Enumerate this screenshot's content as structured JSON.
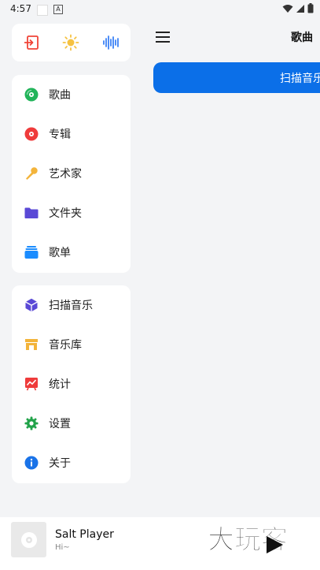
{
  "status": {
    "time": "4:57",
    "notif_letter": "A"
  },
  "quick_actions": [
    {
      "icon": "exit-icon",
      "color": "#f04438"
    },
    {
      "icon": "sun-icon",
      "color": "#f5c242"
    },
    {
      "icon": "waveform-icon",
      "color": "#3b82f6"
    }
  ],
  "library_nav": [
    {
      "label": "歌曲",
      "icon": "song-disc-icon",
      "color": "#22b45a"
    },
    {
      "label": "专辑",
      "icon": "album-icon",
      "color": "#ef3b3b"
    },
    {
      "label": "艺术家",
      "icon": "microphone-icon",
      "color": "#f3b43b"
    },
    {
      "label": "文件夹",
      "icon": "folder-icon",
      "color": "#5a49d6"
    },
    {
      "label": "歌单",
      "icon": "playlist-icon",
      "color": "#1a8cff"
    }
  ],
  "tools_nav": [
    {
      "label": "扫描音乐",
      "icon": "cube-icon",
      "color": "#5a49d6"
    },
    {
      "label": "音乐库",
      "icon": "store-icon",
      "color": "#f3b43b"
    },
    {
      "label": "统计",
      "icon": "chart-icon",
      "color": "#ef3b3b"
    },
    {
      "label": "设置",
      "icon": "gear-icon",
      "color": "#22a34a"
    },
    {
      "label": "关于",
      "icon": "info-icon",
      "color": "#1a73e8"
    }
  ],
  "main": {
    "title": "歌曲",
    "scan_button": "扫描音乐"
  },
  "player": {
    "title": "Salt Player",
    "subtitle": "Hi~"
  },
  "watermark": "大玩客"
}
